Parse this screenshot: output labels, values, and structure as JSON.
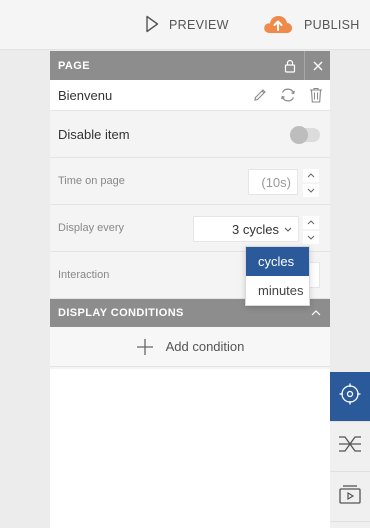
{
  "topbar": {
    "preview_label": "PREVIEW",
    "publish_label": "PUBLISH"
  },
  "panel": {
    "title": "PAGE",
    "item_name": "Bienvenu",
    "disable_item_label": "Disable item",
    "disable_item_on": false,
    "time_on_page_label": "Time on page",
    "time_on_page_value": "(10s)",
    "display_every_label": "Display every",
    "display_every_value": "3 cycles",
    "interaction_label": "Interaction"
  },
  "dropdown": {
    "options": [
      "cycles",
      "minutes"
    ],
    "selected": "cycles"
  },
  "display_conditions": {
    "title": "DISPLAY CONDITIONS",
    "add_label": "Add condition"
  },
  "colors": {
    "accent": "#2b5a9b",
    "header_gray": "#8d8d8d",
    "publish_orange": "#f08a4b"
  },
  "icons": {
    "preview": "play-triangle-icon",
    "publish": "cloud-upload-icon",
    "lock": "lock-icon",
    "close": "close-icon",
    "edit": "pencil-icon",
    "refresh": "refresh-icon",
    "delete": "trash-icon",
    "target": "target-icon",
    "transitions": "transition-icon",
    "slides": "slides-icon"
  }
}
